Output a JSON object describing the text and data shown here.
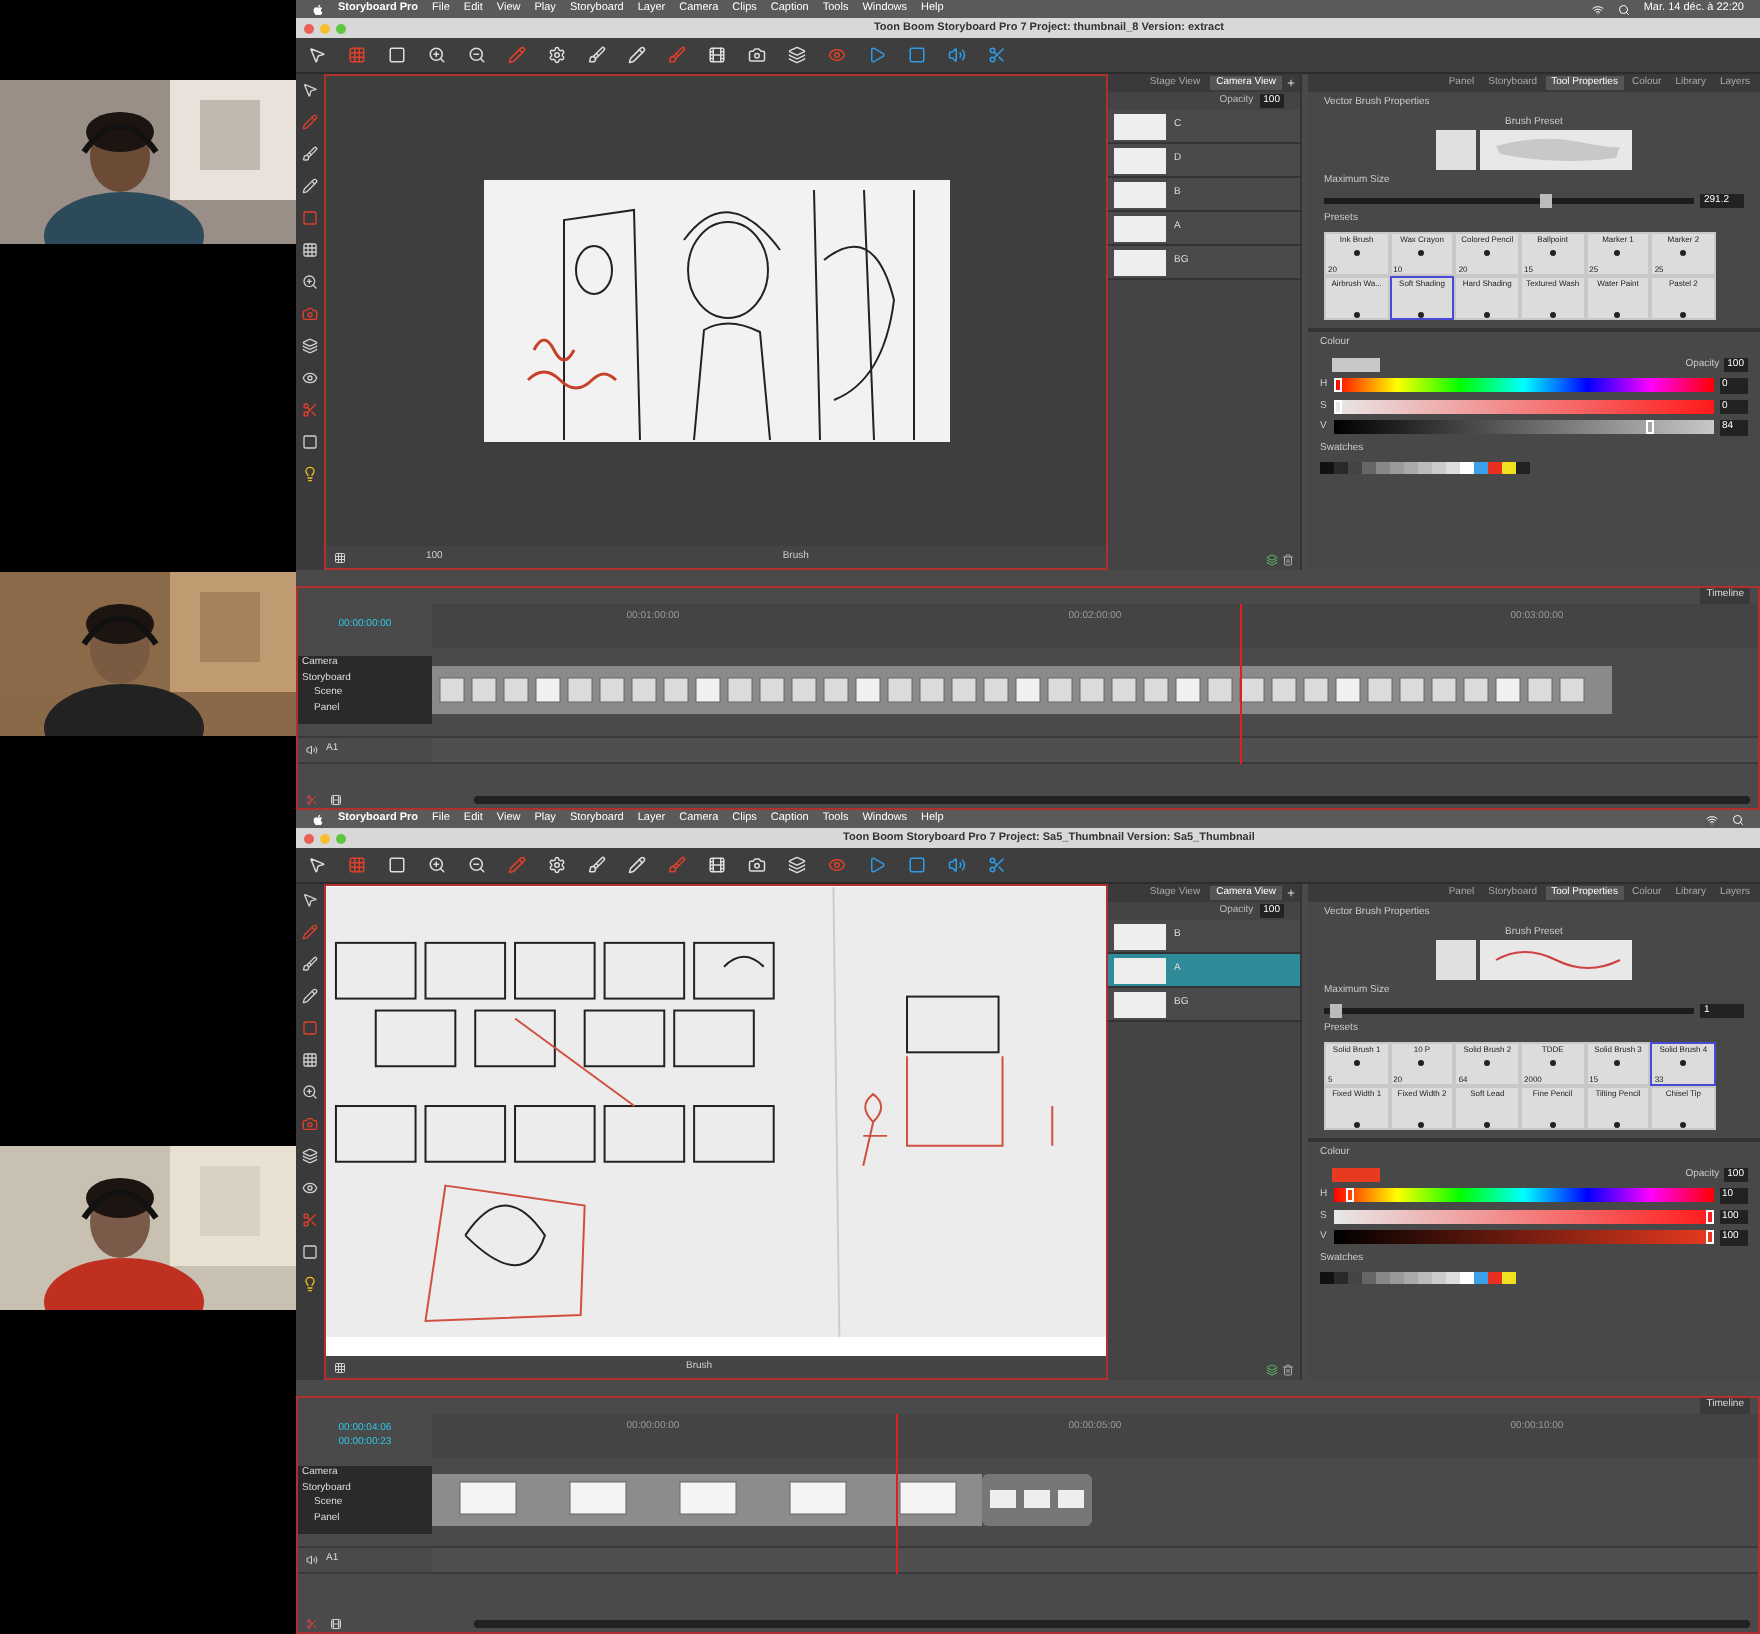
{
  "windows": [
    {
      "menubar": {
        "app": "Storyboard Pro",
        "items": [
          "File",
          "Edit",
          "View",
          "Play",
          "Storyboard",
          "Layer",
          "Camera",
          "Clips",
          "Caption",
          "Tools",
          "Windows",
          "Help"
        ],
        "clock": "Mar. 14 déc. à 22:20"
      },
      "title": "Toon Boom Storyboard Pro 7 Project: thumbnail_8 Version: extract",
      "view_tabs": [
        {
          "label": "Stage View",
          "selected": false
        },
        {
          "label": "Camera View",
          "selected": true
        }
      ],
      "opacity_label": "Opacity",
      "opacity_value": "100",
      "layers": [
        {
          "name": "C",
          "selected": false
        },
        {
          "name": "D",
          "selected": false
        },
        {
          "name": "B",
          "selected": false
        },
        {
          "name": "A",
          "selected": false
        },
        {
          "name": "BG",
          "selected": false
        }
      ],
      "canvas": {
        "kind": "frame",
        "zoom": "100",
        "tool": "Brush"
      },
      "panel_tabs": [
        {
          "label": "Panel",
          "selected": false
        },
        {
          "label": "Storyboard",
          "selected": false
        },
        {
          "label": "Tool Properties",
          "selected": true
        },
        {
          "label": "Colour",
          "selected": false
        },
        {
          "label": "Library",
          "selected": false
        },
        {
          "label": "Layers",
          "selected": false
        }
      ],
      "brush": {
        "title": "Vector Brush Properties",
        "preset_label": "Brush Preset",
        "max_size_label": "Maximum Size",
        "max_size_value": "291.2",
        "level": 0.6,
        "presets_title": "Presets",
        "presets": [
          {
            "name": "Ink Brush",
            "size": "20",
            "selected": false
          },
          {
            "name": "Wax Crayon",
            "size": "10",
            "selected": false
          },
          {
            "name": "Colored Pencil",
            "size": "20",
            "selected": false
          },
          {
            "name": "Ballpoint",
            "size": "15",
            "selected": false
          },
          {
            "name": "Marker 1",
            "size": "25",
            "selected": false
          },
          {
            "name": "Marker 2",
            "size": "25",
            "selected": false
          },
          {
            "name": "Airbrush Wa...",
            "selected": false
          },
          {
            "name": "Soft Shading",
            "selected": true
          },
          {
            "name": "Hard Shading",
            "selected": false
          },
          {
            "name": "Textured Wash",
            "selected": false
          },
          {
            "name": "Water Paint",
            "selected": false
          },
          {
            "name": "Pastel 2",
            "selected": false
          }
        ]
      },
      "colour": {
        "title": "Colour",
        "color": "#c8c8c8",
        "opacity_label": "Opacity",
        "opacity_value": "100",
        "sliders": [
          {
            "label": "H",
            "kind": "hue",
            "value": "0",
            "level": 0
          },
          {
            "label": "S",
            "kind": "sat",
            "value": "0",
            "level": 0
          },
          {
            "label": "V",
            "kind": "val",
            "value": "84",
            "level": 0.84
          }
        ]
      },
      "swatches": {
        "title": "Swatches",
        "items": [
          {
            "color": "#111111"
          },
          {
            "color": "#2a2a2a"
          },
          {
            "color": "#444444"
          },
          {
            "color": "#666666"
          },
          {
            "color": "#888888"
          },
          {
            "color": "#9a9a9a"
          },
          {
            "color": "#aaaaaa"
          },
          {
            "color": "#bbbbbb"
          },
          {
            "color": "#cccccc"
          },
          {
            "color": "#dddddd"
          },
          {
            "color": "#ffffff"
          },
          {
            "color": "#3aa0e8"
          },
          {
            "color": "#e83020"
          },
          {
            "color": "#f0e020"
          },
          {
            "color": "#222222"
          }
        ]
      },
      "timeline": {
        "title": "Timeline",
        "times": [
          "00:00:00:00"
        ],
        "ruler": [
          "00:01:00:00",
          "00:02:00:00",
          "00:03:00:00"
        ],
        "playhead": {
          "level": 0.61
        },
        "track_labels": [
          "Camera",
          "Storyboard"
        ],
        "scene_label": "Scene",
        "panel_label": "Panel",
        "audio_label": "A1"
      }
    },
    {
      "menubar": {
        "app": "Storyboard Pro",
        "items": [
          "File",
          "Edit",
          "View",
          "Play",
          "Storyboard",
          "Layer",
          "Camera",
          "Clips",
          "Caption",
          "Tools",
          "Windows",
          "Help"
        ]
      },
      "title": "Toon Boom Storyboard Pro 7 Project: Sa5_Thumbnail Version: Sa5_Thumbnail",
      "view_tabs": [
        {
          "label": "Stage View",
          "selected": false
        },
        {
          "label": "Camera View",
          "selected": true
        }
      ],
      "opacity_label": "Opacity",
      "opacity_value": "100",
      "layers": [
        {
          "name": "B",
          "selected": false
        },
        {
          "name": "A",
          "selected": true
        },
        {
          "name": "BG",
          "selected": false
        }
      ],
      "canvas": {
        "kind": "sheet",
        "tool": "Brush"
      },
      "panel_tabs": [
        {
          "label": "Panel",
          "selected": false
        },
        {
          "label": "Storyboard",
          "selected": false
        },
        {
          "label": "Tool Properties",
          "selected": true
        },
        {
          "label": "Colour",
          "selected": false
        },
        {
          "label": "Library",
          "selected": false
        },
        {
          "label": "Layers",
          "selected": false
        }
      ],
      "brush": {
        "title": "Vector Brush Properties",
        "preset_label": "Brush Preset",
        "max_size_label": "Maximum Size",
        "max_size_value": "1",
        "level": 0.03,
        "presets_title": "Presets",
        "presets": [
          {
            "name": "Solid Brush 1",
            "size": "5",
            "selected": false
          },
          {
            "name": "10 P",
            "size": "20",
            "selected": false
          },
          {
            "name": "Solid Brush 2",
            "size": "64",
            "selected": false
          },
          {
            "name": "TDDE",
            "size": "2000",
            "selected": false
          },
          {
            "name": "Solid Brush 3",
            "size": "15",
            "selected": false
          },
          {
            "name": "Solid Brush 4",
            "size": "33",
            "selected": true
          },
          {
            "name": "Fixed Width 1",
            "selected": false
          },
          {
            "name": "Fixed Width 2",
            "selected": false
          },
          {
            "name": "Soft Lead",
            "selected": false
          },
          {
            "name": "Fine Pencil",
            "selected": false
          },
          {
            "name": "Tilting Pencil",
            "selected": false
          },
          {
            "name": "Chisel Tip",
            "selected": false
          }
        ]
      },
      "colour": {
        "title": "Colour",
        "color": "#e83a1f",
        "opacity_label": "Opacity",
        "opacity_value": "100",
        "sliders": [
          {
            "label": "H",
            "kind": "hue",
            "value": "10",
            "level": 0.03
          },
          {
            "label": "S",
            "kind": "sat",
            "value": "100",
            "level": 1
          },
          {
            "label": "V",
            "kind": "val",
            "value": "100",
            "level": 1
          }
        ]
      },
      "swatches": {
        "title": "Swatches",
        "items": [
          {
            "color": "#111111"
          },
          {
            "color": "#2a2a2a"
          },
          {
            "color": "#444444"
          },
          {
            "color": "#666666"
          },
          {
            "color": "#888888"
          },
          {
            "color": "#9a9a9a"
          },
          {
            "color": "#aaaaaa"
          },
          {
            "color": "#bbbbbb"
          },
          {
            "color": "#cccccc"
          },
          {
            "color": "#dddddd"
          },
          {
            "color": "#ffffff"
          },
          {
            "color": "#3aa0e8"
          },
          {
            "color": "#e83020"
          },
          {
            "color": "#f0e020"
          }
        ]
      },
      "timeline": {
        "title": "Timeline",
        "times": [
          "00:00:04:06",
          "00:00:00:23"
        ],
        "ruler": [
          "00:00:00:00",
          "00:00:05:00",
          "00:00:10:00"
        ],
        "playhead": {
          "level": 0.35
        },
        "track_labels": [
          "Camera",
          "Storyboard"
        ],
        "scene_label": "Scene",
        "panel_label": "Panel",
        "audio_label": "A1"
      }
    }
  ]
}
